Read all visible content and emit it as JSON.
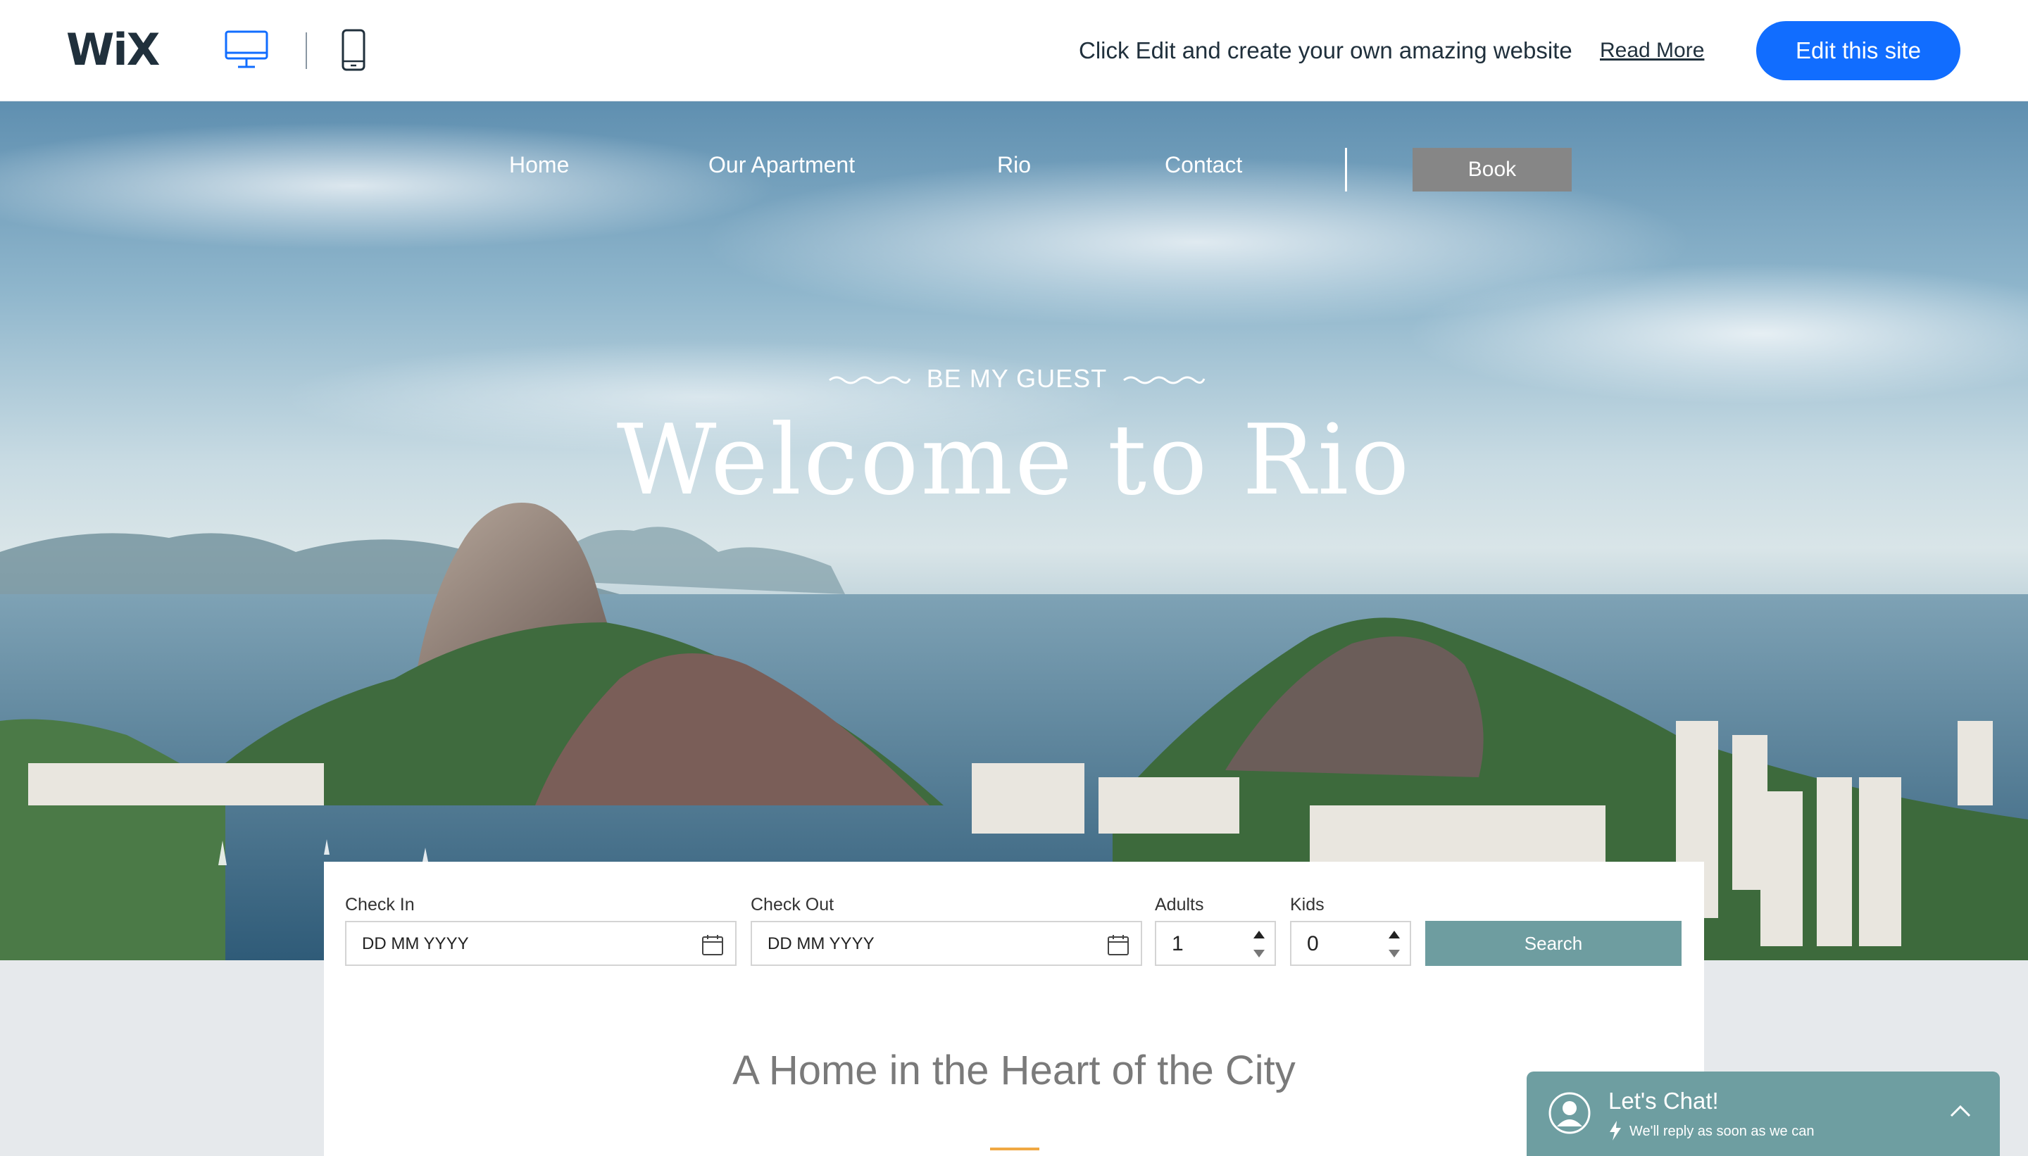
{
  "wix_bar": {
    "logo": "WiX",
    "promo": "Click Edit and create your own amazing website",
    "read_more": "Read More",
    "edit_button": "Edit this site",
    "view_icons": [
      "desktop-icon",
      "mobile-icon"
    ],
    "accent_color": "#116dff"
  },
  "nav": {
    "items": [
      "Home",
      "Our Apartment",
      "Rio",
      "Contact"
    ],
    "book": "Book"
  },
  "hero": {
    "kicker": "BE MY GUEST",
    "title": "Welcome to Rio"
  },
  "booking": {
    "check_in": {
      "label": "Check In",
      "value": "DD MM YYYY"
    },
    "check_out": {
      "label": "Check Out",
      "value": "DD MM YYYY"
    },
    "adults": {
      "label": "Adults",
      "value": "1"
    },
    "kids": {
      "label": "Kids",
      "value": "0"
    },
    "search": "Search",
    "button_color": "#6e9da0"
  },
  "section": {
    "title": "A Home in the Heart of the City",
    "accent_color": "#f0a843"
  },
  "chat": {
    "title": "Let's Chat!",
    "subtitle": "We'll reply as soon as we can",
    "color": "#6e9ea1"
  }
}
